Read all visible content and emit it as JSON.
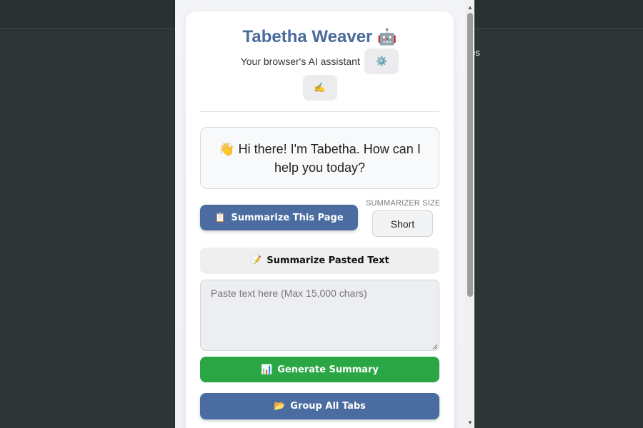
{
  "background": {
    "partial_text": "ges"
  },
  "popup": {
    "title": "Tabetha Weaver",
    "title_emoji": "🤖",
    "subtitle": "Your browser's AI assistant",
    "settings_icon_glyph": "⚙️",
    "writing_icon_glyph": "✍️",
    "greeting": {
      "emoji": "👋",
      "text": "Hi there! I'm Tabetha. How can I help you today?"
    },
    "summarize_page": {
      "icon": "📋",
      "label": "Summarize This Page"
    },
    "summarizer_size": {
      "label": "SUMMARIZER SIZE",
      "value": "Short"
    },
    "summarize_pasted": {
      "icon": "📝",
      "label": "Summarize Pasted Text"
    },
    "paste_input": {
      "placeholder": "Paste text here (Max 15,000 chars)",
      "value": ""
    },
    "generate_summary": {
      "icon": "📊",
      "label": "Generate Summary"
    },
    "group_tabs": {
      "icon": "📂",
      "label": "Group All Tabs"
    }
  },
  "colors": {
    "title": "#4a6b9b",
    "primary_button": "#4a6ca0",
    "generate_button": "#2aa744",
    "page_background": "#2e3536"
  },
  "icons": {
    "title_icon": "robot-icon",
    "settings_icon": "gear-icon",
    "writing_icon": "writing-hand-icon",
    "greeting_icon": "waving-hand-icon",
    "summarize_page_icon": "clipboard-icon",
    "summarize_pasted_icon": "memo-icon",
    "generate_icon": "bar-chart-icon",
    "group_tabs_icon": "folder-icon"
  }
}
